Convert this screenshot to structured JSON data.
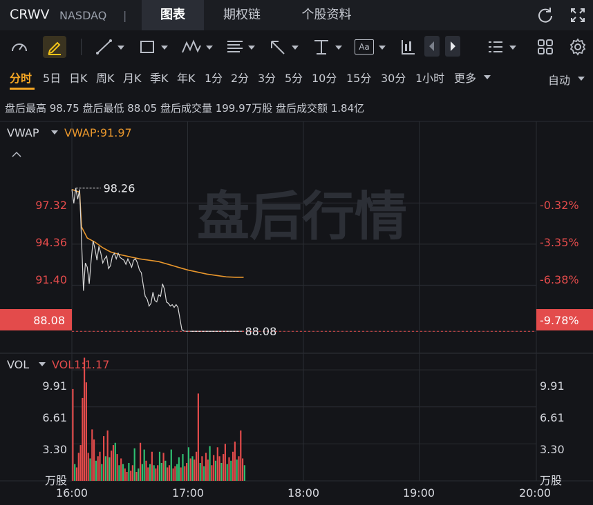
{
  "header": {
    "ticker": "CRWV",
    "exchange": "NASDAQ",
    "separator": "|",
    "tabs": [
      "图表",
      "期权链",
      "个股资料"
    ]
  },
  "toolbar": {
    "icons": [
      "gauge-icon",
      "highlighter-icon",
      "line-tool-icon",
      "rectangle-tool-icon",
      "wave-tool-icon",
      "fibonacci-tool-icon",
      "arrow-tool-icon",
      "measure-tool-icon",
      "text-tool-icon",
      "candle-tool-icon",
      "prev-icon",
      "next-icon",
      "list-icon",
      "grid-icon",
      "settings-icon"
    ],
    "text_tool_label": "Aa"
  },
  "periods": {
    "items": [
      "分时",
      "5日",
      "日K",
      "周K",
      "月K",
      "季K",
      "年K",
      "1分",
      "2分",
      "3分",
      "5分",
      "10分",
      "15分",
      "30分",
      "1小时",
      "更多"
    ],
    "selected": "分时",
    "auto_label": "自动"
  },
  "info": {
    "text": "盘后最高 98.75  盘后最低 88.05  盘后成交量 199.97万股  盘后成交额 1.84亿"
  },
  "price_panel": {
    "indicator": "VWAP",
    "indicator_value": "VWAP:91.97",
    "watermark": "盘后行情",
    "high_marker": "98.26",
    "low_marker": "88.08",
    "current_price": "88.08",
    "current_pct": "-9.78%",
    "left_labels": [
      "97.32",
      "94.36",
      "91.40"
    ],
    "right_labels": [
      "-0.32%",
      "-3.35%",
      "-6.38%"
    ]
  },
  "volume_panel": {
    "indicator": "VOL",
    "indicator_value": "VOL1:1.17",
    "left_labels": [
      "9.91",
      "6.61",
      "3.30"
    ],
    "right_labels": [
      "9.91",
      "6.61",
      "3.30"
    ],
    "unit": "万股"
  },
  "time_axis": [
    "16:00",
    "17:00",
    "18:00",
    "19:00",
    "20:00"
  ],
  "colors": {
    "up": "#e34b4b",
    "down": "#2fbf71",
    "vwap": "#e8962c",
    "price": "#d8d8d8",
    "accent": "#f5a623"
  },
  "chart_data": {
    "type": "line",
    "x_unit": "minutes after 16:00",
    "price": {
      "ylim": [
        86.5,
        103.2
      ],
      "x": [
        0,
        1,
        2,
        3,
        4,
        5,
        6,
        7,
        8,
        9,
        10,
        11,
        12,
        13,
        14,
        15,
        16,
        17,
        18,
        19,
        20,
        21,
        22,
        23,
        24,
        25,
        26,
        27,
        28,
        29,
        30,
        31,
        32,
        33,
        34,
        35,
        36,
        37,
        38,
        39,
        40,
        41,
        42,
        43,
        44,
        45,
        46,
        47,
        48,
        49,
        50,
        51,
        52,
        53,
        54,
        55,
        56,
        57,
        58,
        59,
        60,
        61,
        62,
        63,
        64,
        65,
        66,
        67,
        68,
        69,
        70,
        71,
        72,
        73,
        74,
        75,
        76,
        77,
        78,
        79,
        80,
        81,
        82,
        83,
        84,
        85,
        86,
        87,
        88,
        89
      ],
      "values": [
        98.3,
        97.3,
        98.4,
        97.6,
        98.3,
        94.6,
        91.0,
        93.0,
        92.7,
        91.5,
        93.2,
        94.6,
        94.0,
        93.2,
        94.2,
        93.7,
        93.0,
        93.3,
        93.5,
        92.6,
        92.8,
        93.5,
        93.7,
        93.3,
        93.7,
        93.4,
        93.3,
        93.2,
        92.9,
        93.3,
        93.0,
        92.7,
        93.2,
        93.3,
        93.0,
        92.5,
        92.3,
        91.4,
        90.6,
        90.4,
        89.9,
        90.1,
        90.9,
        90.3,
        90.2,
        90.7,
        90.6,
        91.5,
        91.1,
        90.2,
        90.1,
        89.9,
        90.0,
        89.8,
        90.0,
        89.8,
        89.0,
        88.2,
        88.1,
        88.08,
        88.08,
        88.08,
        88.08,
        88.08,
        88.08,
        88.08,
        88.08,
        88.08,
        88.08,
        88.08,
        88.08,
        88.08,
        88.08,
        88.08,
        88.08,
        88.08,
        88.08,
        88.08,
        88.08,
        88.08,
        88.08,
        88.08,
        88.08,
        88.08,
        88.08,
        88.08,
        88.08,
        88.08,
        88.08,
        88.08
      ]
    },
    "vwap": {
      "x": [
        0,
        4,
        5,
        8,
        12,
        16,
        20,
        25,
        30,
        35,
        40,
        45,
        50,
        55,
        60,
        65,
        70,
        75,
        80,
        85,
        89
      ],
      "values": [
        98.3,
        98.1,
        95.6,
        94.8,
        94.5,
        94.1,
        93.8,
        93.6,
        93.45,
        93.3,
        93.2,
        93.1,
        92.9,
        92.7,
        92.5,
        92.35,
        92.2,
        92.1,
        92.0,
        91.97,
        91.97
      ]
    },
    "volume": {
      "ylim": [
        0,
        11.4
      ],
      "x": [
        0,
        1,
        2,
        3,
        4,
        5,
        6,
        7,
        8,
        9,
        10,
        11,
        12,
        13,
        14,
        15,
        16,
        17,
        18,
        19,
        20,
        21,
        22,
        23,
        24,
        25,
        26,
        27,
        28,
        29,
        30,
        31,
        32,
        33,
        34,
        35,
        36,
        37,
        38,
        39,
        40,
        41,
        42,
        43,
        44,
        45,
        46,
        47,
        48,
        49,
        50,
        51,
        52,
        53,
        54,
        55,
        56,
        57,
        58,
        59,
        60,
        61,
        62,
        63,
        64,
        65,
        66,
        67,
        68,
        69,
        70,
        71,
        72,
        73,
        74,
        75,
        76,
        77,
        78,
        79,
        80,
        81,
        82,
        83,
        84,
        85,
        86,
        87,
        88,
        89
      ],
      "values": [
        8.2,
        1.5,
        1.2,
        2.5,
        3.2,
        7.4,
        11.0,
        8.8,
        2.5,
        2.0,
        4.6,
        3.7,
        1.8,
        2.2,
        2.6,
        1.5,
        4.0,
        2.2,
        4.5,
        2.1,
        2.7,
        3.2,
        3.4,
        2.4,
        1.4,
        2.0,
        1.5,
        1.1,
        0.8,
        1.6,
        0.9,
        1.4,
        2.9,
        0.8,
        1.1,
        3.4,
        1.5,
        2.8,
        1.8,
        1.2,
        1.5,
        2.6,
        1.4,
        1.1,
        1.4,
        2.6,
        1.6,
        2.5,
        1.8,
        1.2,
        1.4,
        2.8,
        1.1,
        1.3,
        1.5,
        2.1,
        1.2,
        2.4,
        1.3,
        1.6,
        3.0,
        2.0,
        2.2,
        1.9,
        2.6,
        7.8,
        1.6,
        2.2,
        1.3,
        2.5,
        1.9,
        3.1,
        1.4,
        2.3,
        1.8,
        3.0,
        2.2,
        1.6,
        2.4,
        3.3,
        1.5,
        2.1,
        1.8,
        2.6,
        3.5,
        1.9,
        2.2,
        4.5,
        2.0,
        1.4
      ],
      "up": [
        true,
        false,
        true,
        true,
        true,
        true,
        true,
        true,
        true,
        false,
        true,
        true,
        false,
        true,
        true,
        false,
        true,
        false,
        true,
        false,
        true,
        true,
        false,
        true,
        false,
        true,
        false,
        true,
        true,
        false,
        true,
        true,
        false,
        true,
        false,
        true,
        false,
        false,
        true,
        true,
        false,
        true,
        false,
        true,
        true,
        false,
        false,
        true,
        false,
        true,
        true,
        false,
        true,
        true,
        false,
        false,
        true,
        false,
        true,
        true,
        false,
        true,
        false,
        true,
        true,
        true,
        false,
        true,
        false,
        true,
        true,
        false,
        true,
        true,
        false,
        true,
        true,
        false,
        true,
        true,
        false,
        true,
        false,
        true,
        true,
        false,
        true,
        true,
        true,
        false
      ]
    },
    "xlim": [
      0,
      240
    ],
    "xticks": [
      "16:00",
      "17:00",
      "18:00",
      "19:00",
      "20:00"
    ]
  }
}
